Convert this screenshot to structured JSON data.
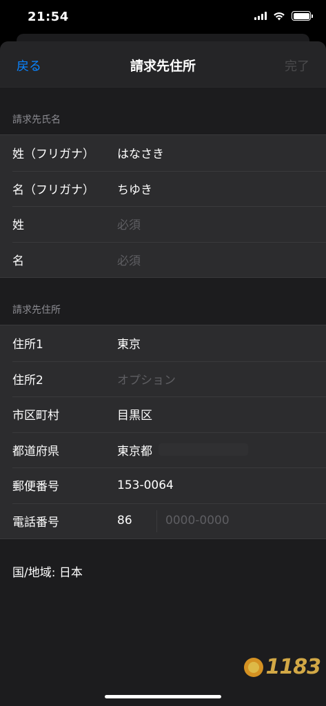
{
  "status_bar": {
    "time": "21:54",
    "signal_icon": "cellular-signal-icon",
    "wifi_icon": "wifi-icon",
    "battery_icon": "battery-icon"
  },
  "nav": {
    "back_label": "戻る",
    "title": "請求先住所",
    "done_label": "完了"
  },
  "name_section": {
    "header": "請求先氏名",
    "rows": [
      {
        "label": "姓（フリガナ）",
        "value": "はなさき",
        "placeholder": ""
      },
      {
        "label": "名（フリガナ）",
        "value": "ちゆき",
        "placeholder": ""
      },
      {
        "label": "姓",
        "value": "",
        "placeholder": "必須"
      },
      {
        "label": "名",
        "value": "",
        "placeholder": "必須"
      }
    ]
  },
  "address_section": {
    "header": "請求先住所",
    "rows": [
      {
        "label": "住所1",
        "value": "東京",
        "placeholder": ""
      },
      {
        "label": "住所2",
        "value": "",
        "placeholder": "オプション"
      },
      {
        "label": "市区町村",
        "value": "目黒区",
        "placeholder": ""
      },
      {
        "label": "都道府県",
        "value": "東京都",
        "placeholder": ""
      },
      {
        "label": "郵便番号",
        "value": "153-0064",
        "placeholder": ""
      }
    ],
    "phone": {
      "label": "電話番号",
      "country_code": "86",
      "number_placeholder": "0000-0000"
    }
  },
  "country": "国/地域: 日本",
  "watermark": {
    "text": "1183",
    "icon": "sun-logo-icon"
  },
  "colors": {
    "accent": "#0a84ff",
    "background": "#1c1c1e",
    "row": "#2c2c2e",
    "placeholder": "#5e5e62"
  }
}
